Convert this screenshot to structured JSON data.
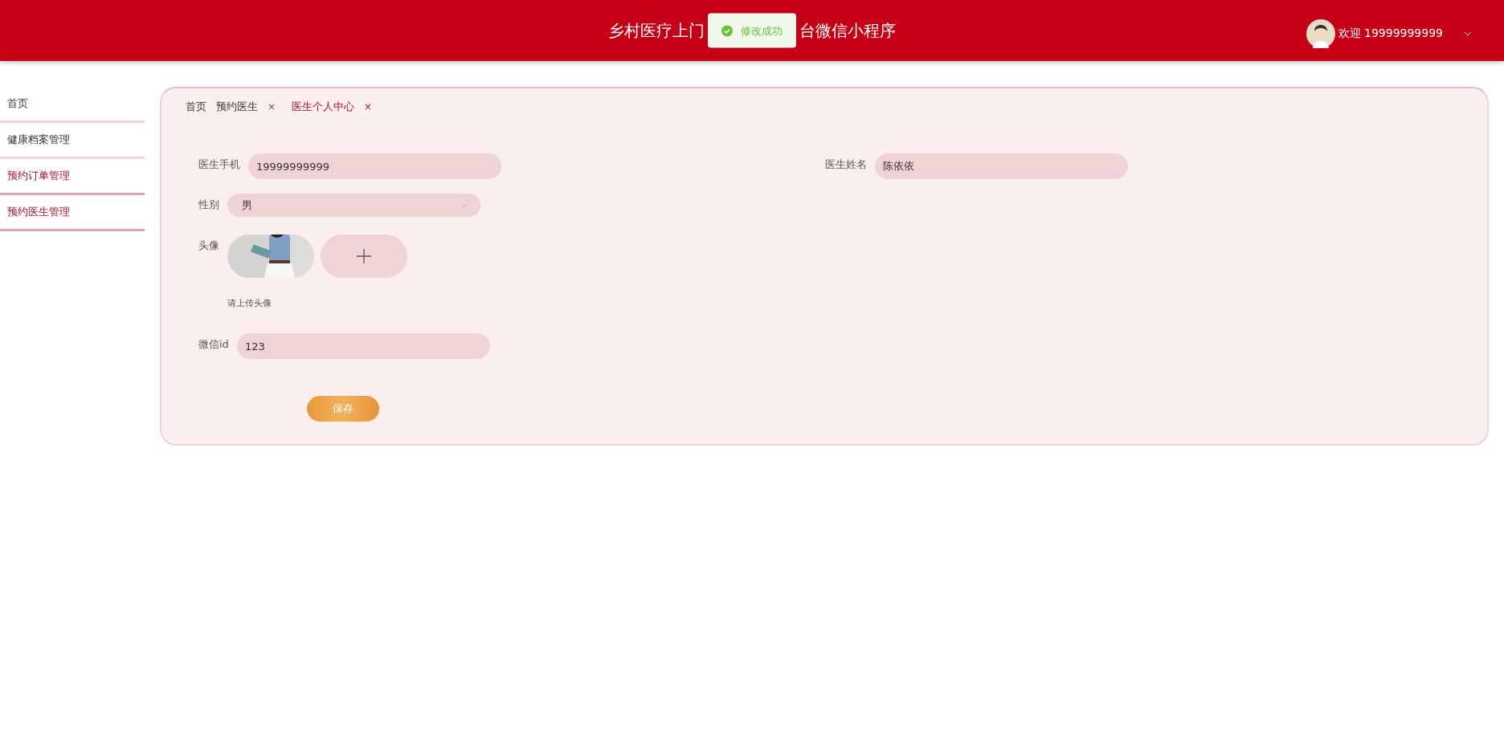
{
  "header": {
    "title_parts": [
      "乡村医疗上门",
      "台微信小程序"
    ],
    "toast": {
      "text": "修改成功"
    },
    "user": {
      "greeting": "欢迎 19999999999"
    }
  },
  "sidebar": {
    "items": [
      {
        "label": "首页",
        "selected": false
      },
      {
        "label": "健康档案管理",
        "selected": false
      },
      {
        "label": "预约订单管理",
        "selected": true
      },
      {
        "label": "预约医生管理",
        "selected": true
      }
    ]
  },
  "tabs": [
    {
      "label": "首页",
      "selected": false
    },
    {
      "label": "预约医生",
      "selected": false,
      "close": "×"
    },
    {
      "label": "医生个人中心",
      "selected": true,
      "close": "×"
    }
  ],
  "form": {
    "phone": {
      "label": "医生手机",
      "value": "19999999999"
    },
    "name": {
      "label": "医生姓名",
      "value": "陈依依"
    },
    "gender": {
      "label": "性别",
      "value": "男"
    },
    "avatar": {
      "label": "头像",
      "hint": "请上传头像"
    },
    "wechat": {
      "label": "微信id",
      "value": "123"
    },
    "save": {
      "label": "保存"
    }
  }
}
